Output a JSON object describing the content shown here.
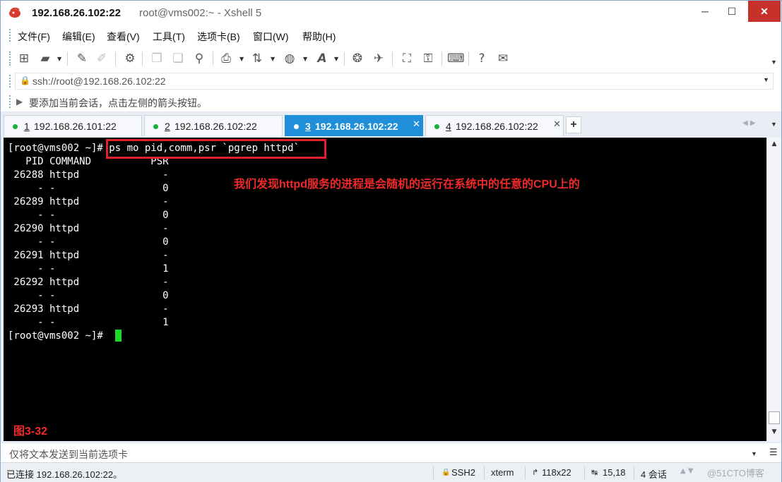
{
  "titlebar": {
    "host": "192.168.26.102:22",
    "rest": "root@vms002:~ - Xshell 5",
    "minimize": "─",
    "maximize": "☐",
    "close": "✕"
  },
  "menu": [
    "文件(F)",
    "编辑(E)",
    "查看(V)",
    "工具(T)",
    "选项卡(B)",
    "窗口(W)",
    "帮助(H)"
  ],
  "toolbar": {
    "icons": [
      "new-session-icon",
      "open-folder-icon",
      "connect-icon",
      "disconnect-icon",
      "properties-icon",
      "copy-icon",
      "paste-icon",
      "find-icon",
      "print-icon",
      "transfer-icon",
      "globe-icon",
      "font-icon",
      "xftp-icon",
      "xmanager-icon",
      "fullscreen-icon",
      "lock-icon",
      "keyboard-icon",
      "help-icon",
      "chat-icon"
    ]
  },
  "address": {
    "value": "ssh://root@192.168.26.102:22"
  },
  "hint": {
    "text": "要添加当前会话，点击左侧的箭头按钮。"
  },
  "tabs": [
    {
      "num": "1",
      "host": "192.168.26.101:22",
      "active": false
    },
    {
      "num": "2",
      "host": "192.168.26.102:22",
      "active": false
    },
    {
      "num": "3",
      "host": "192.168.26.102:22",
      "active": true
    },
    {
      "num": "4",
      "host": "192.168.26.102:22",
      "active": false
    }
  ],
  "terminal": {
    "lines": [
      "[root@vms002 ~]# ps mo pid,comm,psr `pgrep httpd`",
      "   PID COMMAND          PSR",
      " 26288 httpd              -",
      "     - -                  0",
      " 26289 httpd              -",
      "     - -                  0",
      " 26290 httpd              -",
      "     - -                  0",
      " 26291 httpd              -",
      "     - -                  1",
      " 26292 httpd              -",
      "     - -                  0",
      " 26293 httpd              -",
      "     - -                  1",
      "[root@vms002 ~]# "
    ],
    "annotation": "我们发现httpd服务的进程是会随机的运行在系统中的任意的CPU上的",
    "figure_label": "图3-32"
  },
  "compose": {
    "text": "仅将文本发送到当前选项卡"
  },
  "status": {
    "connection": "已连接 192.168.26.102:22。",
    "protocol": "SSH2",
    "term": "xterm",
    "size": "118x22",
    "cursor_pos": "15,18",
    "sessions": "4 会话",
    "watermark": "@51CTO博客"
  },
  "colors": {
    "tab_active": "#1e8fd8",
    "annotation": "#ee2a2a",
    "cursor": "#1bd82b",
    "close_button": "#c7312b"
  }
}
